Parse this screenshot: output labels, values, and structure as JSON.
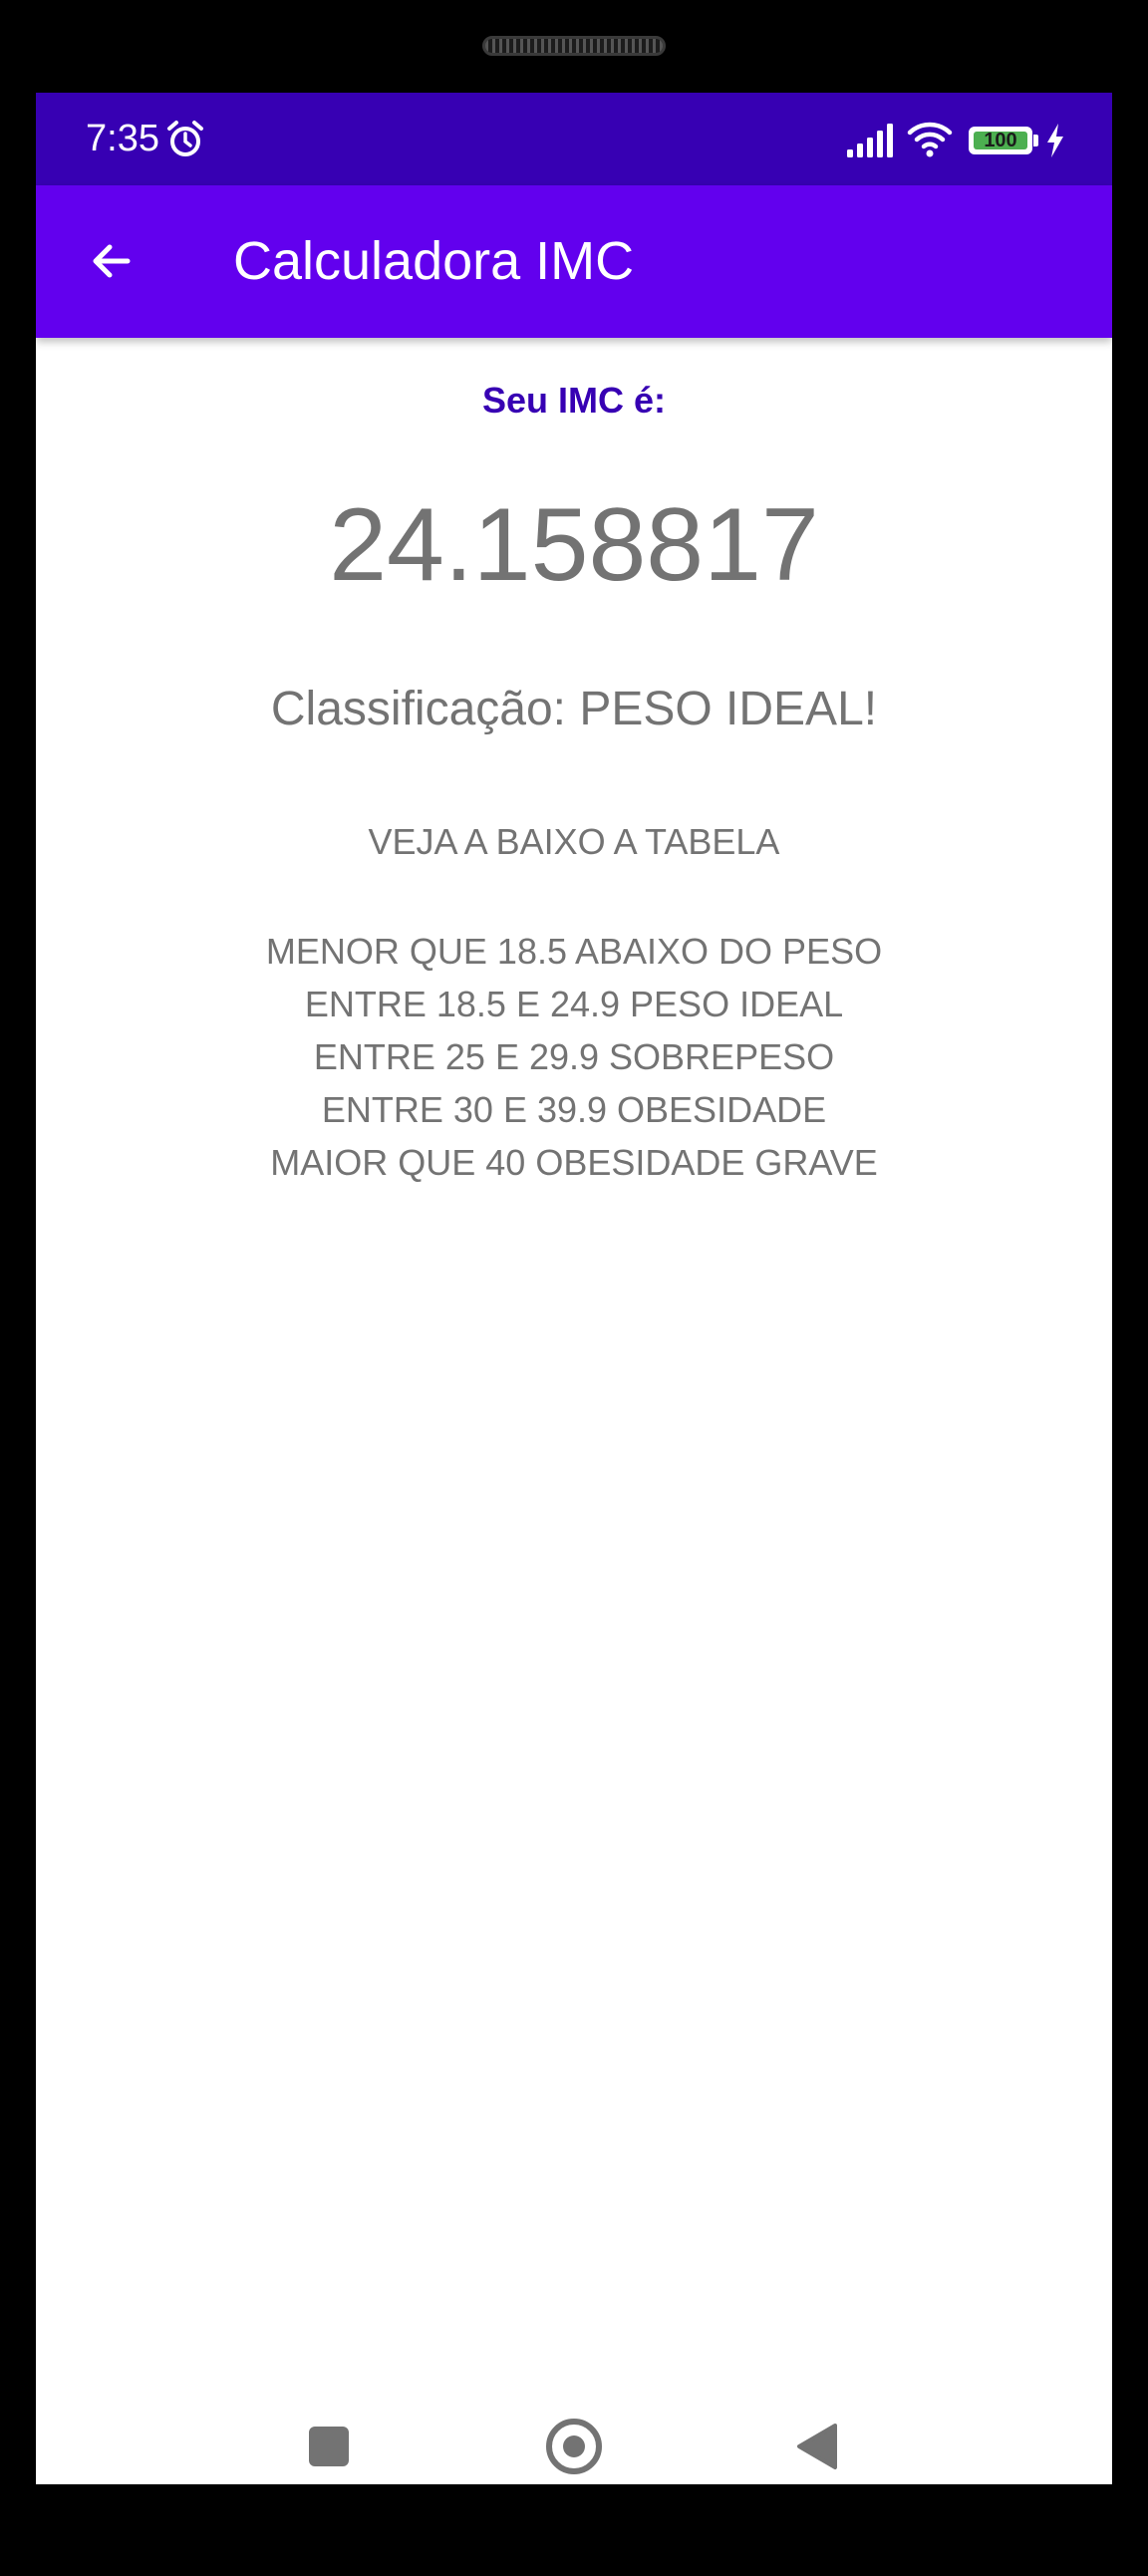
{
  "status_bar": {
    "time": "7:35",
    "battery_level": "100",
    "icons": [
      "alarm-icon",
      "signal-icon",
      "wifi-icon",
      "battery-icon",
      "charging-bolt-icon"
    ]
  },
  "app_bar": {
    "title": "Calculadora IMC",
    "back_icon": "arrow-left-icon"
  },
  "result": {
    "label": "Seu IMC é:",
    "value": "24.158817",
    "classification": "Classificação: PESO IDEAL!"
  },
  "table": {
    "title": "VEJA A BAIXO A TABELA",
    "rows": [
      "MENOR QUE 18.5 ABAIXO DO PESO",
      "ENTRE 18.5 E 24.9 PESO IDEAL",
      "ENTRE 25 E 29.9 SOBREPESO",
      "ENTRE 30 E 39.9 OBESIDADE",
      "MAIOR QUE 40 OBESIDADE GRAVE"
    ]
  },
  "nav_bar": {
    "icons": [
      "recents-icon",
      "home-icon",
      "back-icon"
    ]
  },
  "colors": {
    "status_bar": "#3700b3",
    "app_bar": "#6200ee",
    "label_accent": "#3700b3",
    "body_text": "#737373"
  }
}
